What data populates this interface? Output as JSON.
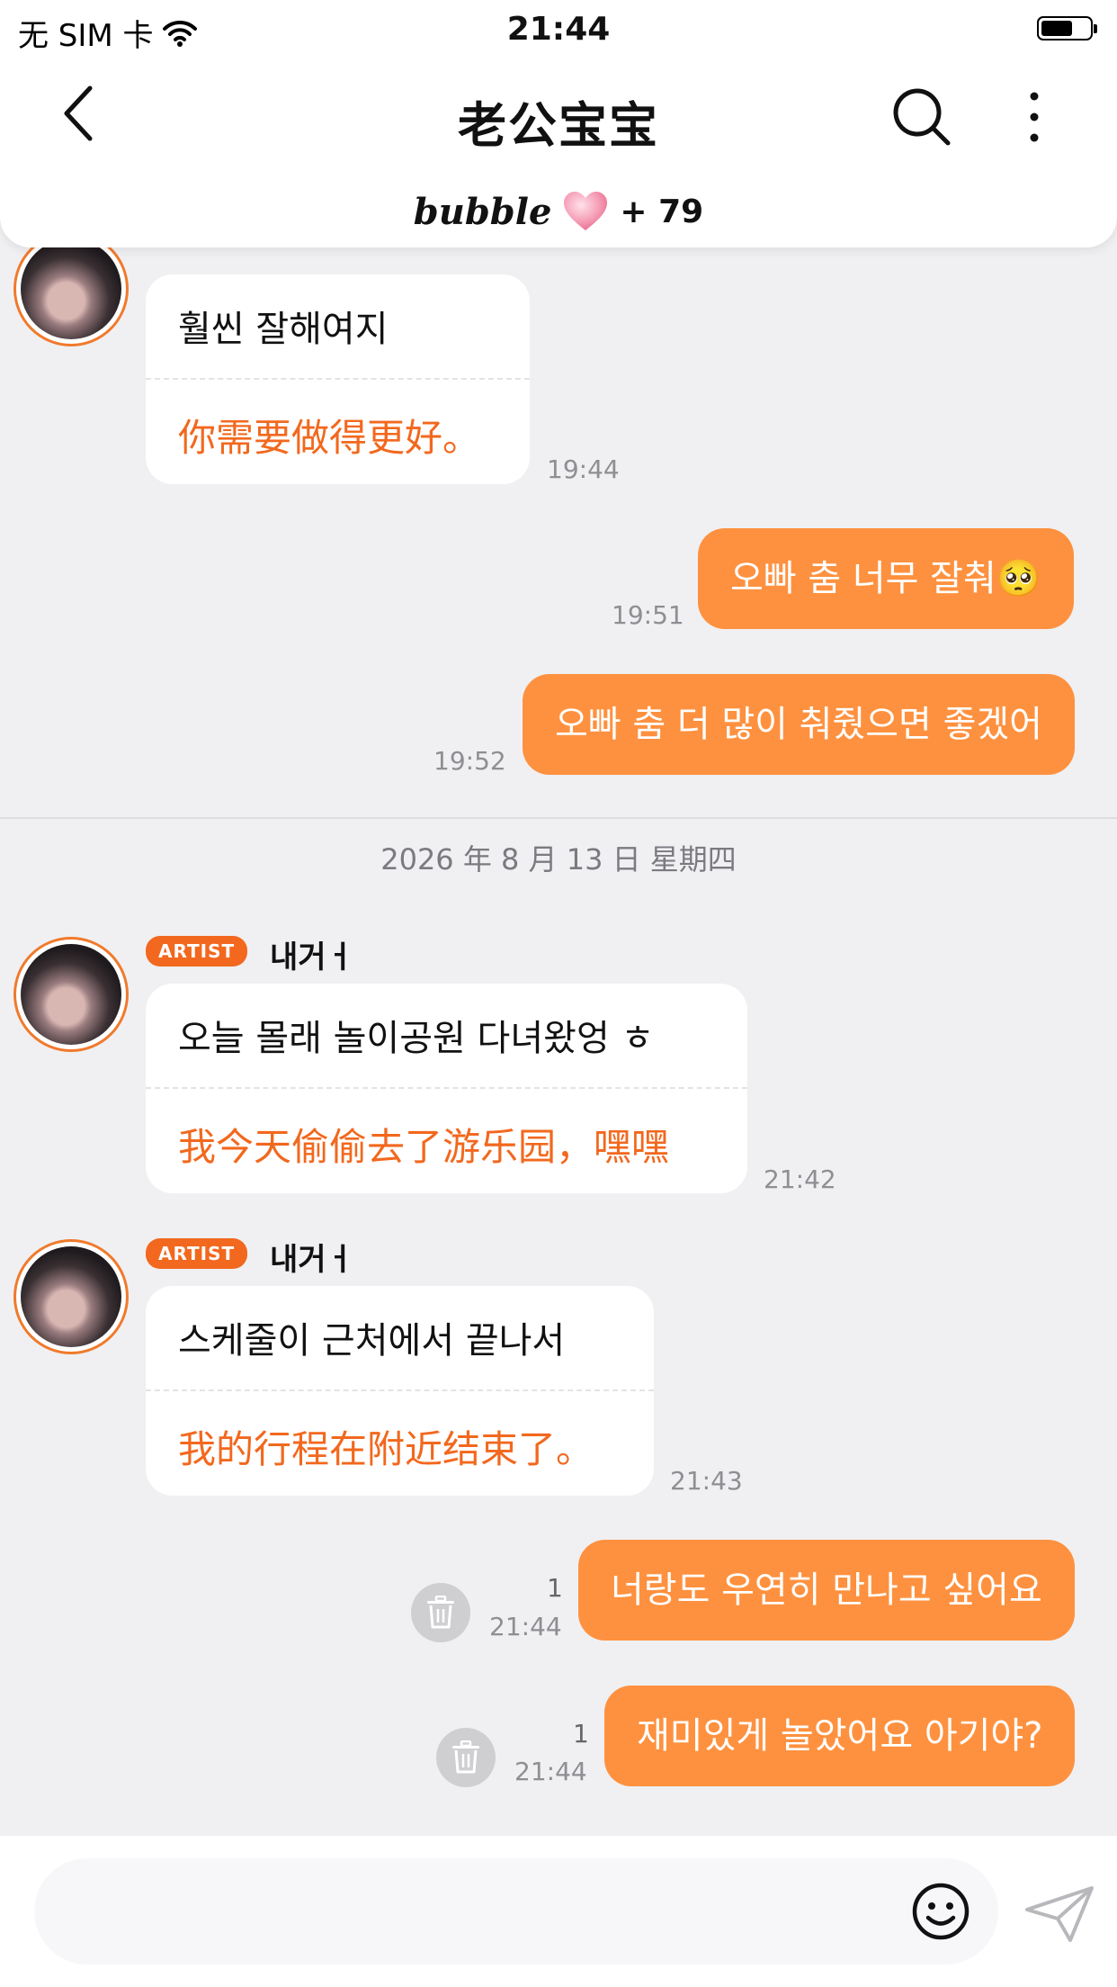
{
  "status_bar": {
    "carrier": "无 SIM 卡",
    "time": "21:44"
  },
  "header": {
    "title": "老公宝宝",
    "bubble_brand": "bubble",
    "bubble_count": "+ 79"
  },
  "colors": {
    "accent": "#fe913f",
    "artist_badge": "#f2681e",
    "translation_text": "#f2681e",
    "background": "#f0f0f2"
  },
  "messages_top": [
    {
      "korean": "훨씬 잘해여지",
      "chinese": "你需要做得更好。",
      "time": "19:44"
    },
    {
      "text": "오빠 춤 너무 잘춰🥺",
      "time": "19:51"
    },
    {
      "text": "오빠 춤 더 많이 춰줬으면 좋겠어",
      "time": "19:52"
    }
  ],
  "date_separator": "2026 年 8 月 13 日 星期四",
  "messages_today": [
    {
      "badge": "ARTIST",
      "sender": "내거ㅓ",
      "korean": "오늘 몰래 놀이공원 다녀왔엉 ㅎ",
      "chinese": "我今天偷偷去了游乐园，嘿嘿",
      "time": "21:42"
    },
    {
      "badge": "ARTIST",
      "sender": "내거ㅓ",
      "korean": "스케줄이 근처에서 끝나서",
      "chinese": "我的行程在附近结束了。",
      "time": "21:43"
    },
    {
      "text": "너랑도 우연히 만나고 싶어요",
      "time": "21:44",
      "unread": "1"
    },
    {
      "text": "재미있게 놀았어요 아기야?",
      "time": "21:44",
      "unread": "1"
    }
  ],
  "input": {
    "placeholder": ""
  },
  "icons": [
    "back-icon",
    "search-icon",
    "more-icon",
    "heart-icon",
    "trash-icon",
    "emoji-icon",
    "send-icon",
    "wifi-icon",
    "battery-icon"
  ]
}
